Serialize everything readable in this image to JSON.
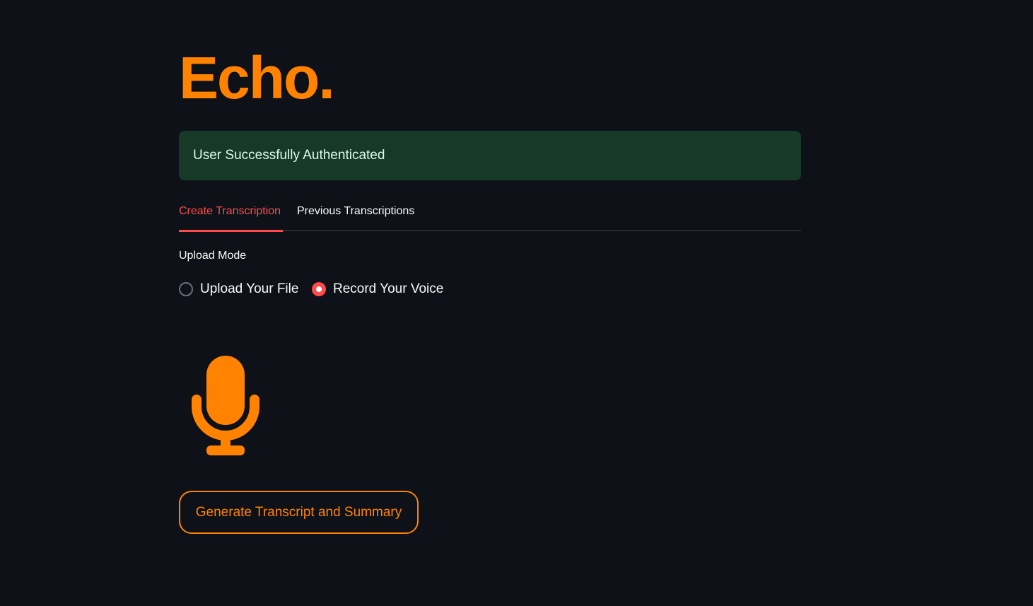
{
  "app": {
    "title": "Echo."
  },
  "alert": {
    "message": "User Successfully Authenticated"
  },
  "tabs": [
    {
      "label": "Create Transcription",
      "active": true
    },
    {
      "label": "Previous Transcriptions",
      "active": false
    }
  ],
  "upload_mode": {
    "label": "Upload Mode",
    "options": [
      {
        "label": "Upload Your File",
        "selected": false
      },
      {
        "label": "Record Your Voice",
        "selected": true
      }
    ]
  },
  "recorder": {
    "icon": "microphone-icon"
  },
  "actions": {
    "generate_label": "Generate Transcript and Summary"
  },
  "colors": {
    "background": "#0e1118",
    "accent": "#ff8200",
    "tab_active": "#ff4b4b",
    "success_bg": "#173928",
    "success_text": "#dff8e8"
  }
}
